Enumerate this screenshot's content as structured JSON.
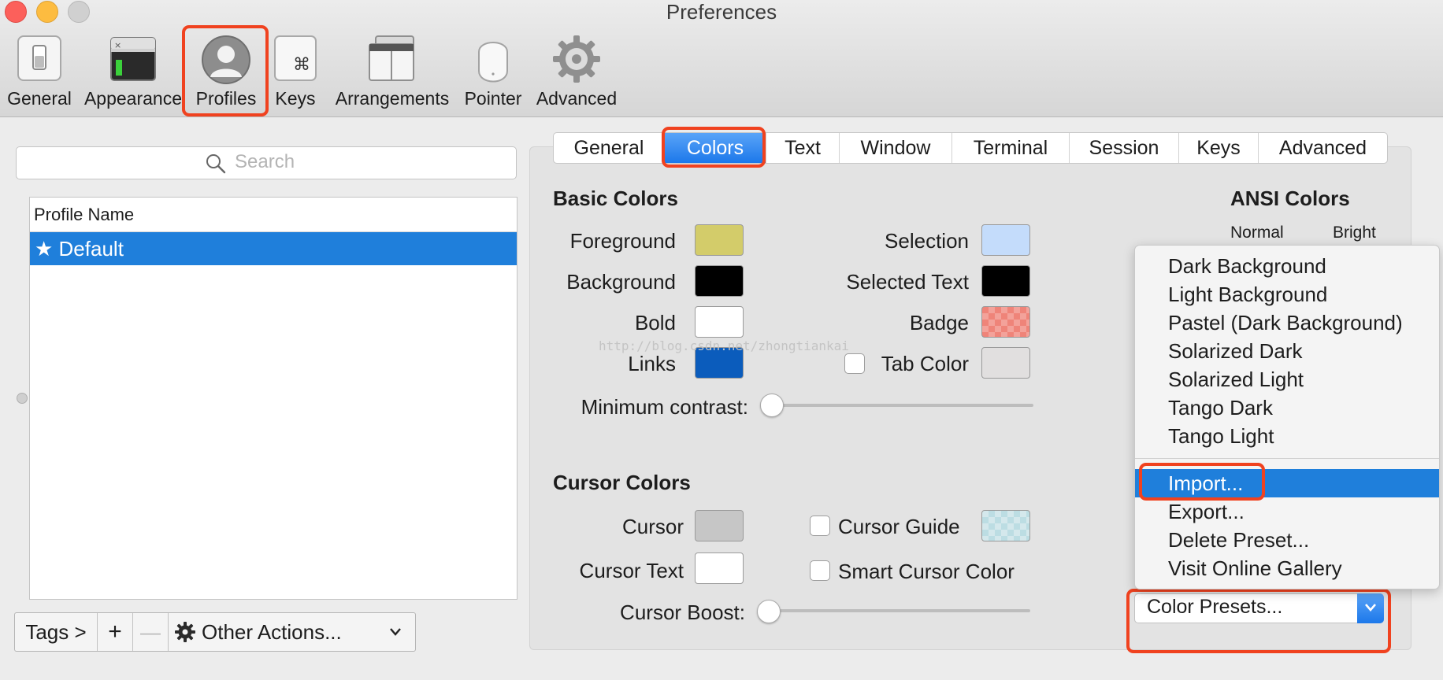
{
  "window": {
    "title": "Preferences"
  },
  "toolbar": {
    "items": [
      {
        "label": "General",
        "icon": "switch-icon"
      },
      {
        "label": "Appearance",
        "icon": "terminal-window-icon"
      },
      {
        "label": "Profiles",
        "icon": "user-silhouette-icon",
        "selected": true
      },
      {
        "label": "Keys",
        "icon": "command-key-icon",
        "glyph": "⌘"
      },
      {
        "label": "Arrangements",
        "icon": "window-arrangement-icon"
      },
      {
        "label": "Pointer",
        "icon": "mouse-icon"
      },
      {
        "label": "Advanced",
        "icon": "gear-icon"
      }
    ]
  },
  "profiles": {
    "search_placeholder": "Search",
    "column_header": "Profile Name",
    "rows": [
      {
        "label": "★ Default",
        "selected": true
      }
    ],
    "bottom": {
      "tags": "Tags >",
      "add": "+",
      "remove": "—",
      "other_actions": "Other Actions..."
    }
  },
  "tabs": [
    "General",
    "Colors",
    "Text",
    "Window",
    "Terminal",
    "Session",
    "Keys",
    "Advanced"
  ],
  "active_tab": "Colors",
  "basic_colors": {
    "title": "Basic Colors",
    "foreground": {
      "label": "Foreground",
      "color": "#d3cc6a"
    },
    "background": {
      "label": "Background",
      "color": "#000000"
    },
    "bold": {
      "label": "Bold",
      "color": "#ffffff"
    },
    "links": {
      "label": "Links",
      "color": "#0b5cbc"
    },
    "selection": {
      "label": "Selection",
      "color": "#c4dcfb"
    },
    "selected_text": {
      "label": "Selected Text",
      "color": "#000000"
    },
    "badge": {
      "label": "Badge",
      "color": "#ef8479"
    },
    "tab_color": {
      "label": "Tab Color",
      "color": "#e1dfdf",
      "checked": false
    },
    "min_contrast": {
      "label": "Minimum contrast:",
      "value": 0
    }
  },
  "cursor_colors": {
    "title": "Cursor Colors",
    "cursor": {
      "label": "Cursor",
      "color": "#c6c6c6"
    },
    "cursor_text": {
      "label": "Cursor Text",
      "color": "#ffffff"
    },
    "cursor_guide": {
      "label": "Cursor Guide",
      "color": "#d4e8ec",
      "checked": false
    },
    "smart_cursor": {
      "label": "Smart Cursor Color",
      "checked": false
    },
    "cursor_boost": {
      "label": "Cursor Boost:",
      "value": 0
    }
  },
  "ansi": {
    "title": "ANSI Colors",
    "normal": "Normal",
    "bright": "Bright"
  },
  "presets_menu": {
    "presets": [
      "Dark Background",
      "Light Background",
      "Pastel (Dark Background)",
      "Solarized Dark",
      "Solarized Light",
      "Tango Dark",
      "Tango Light"
    ],
    "actions": [
      "Import...",
      "Export...",
      "Delete Preset...",
      "Visit Online Gallery"
    ],
    "highlighted": "Import..."
  },
  "color_presets_button": "Color Presets...",
  "watermark": "http://blog.csdn.net/zhongtiankai",
  "colors": {
    "accent": "#1f7fdb",
    "highlight_box": "#f0421f"
  }
}
